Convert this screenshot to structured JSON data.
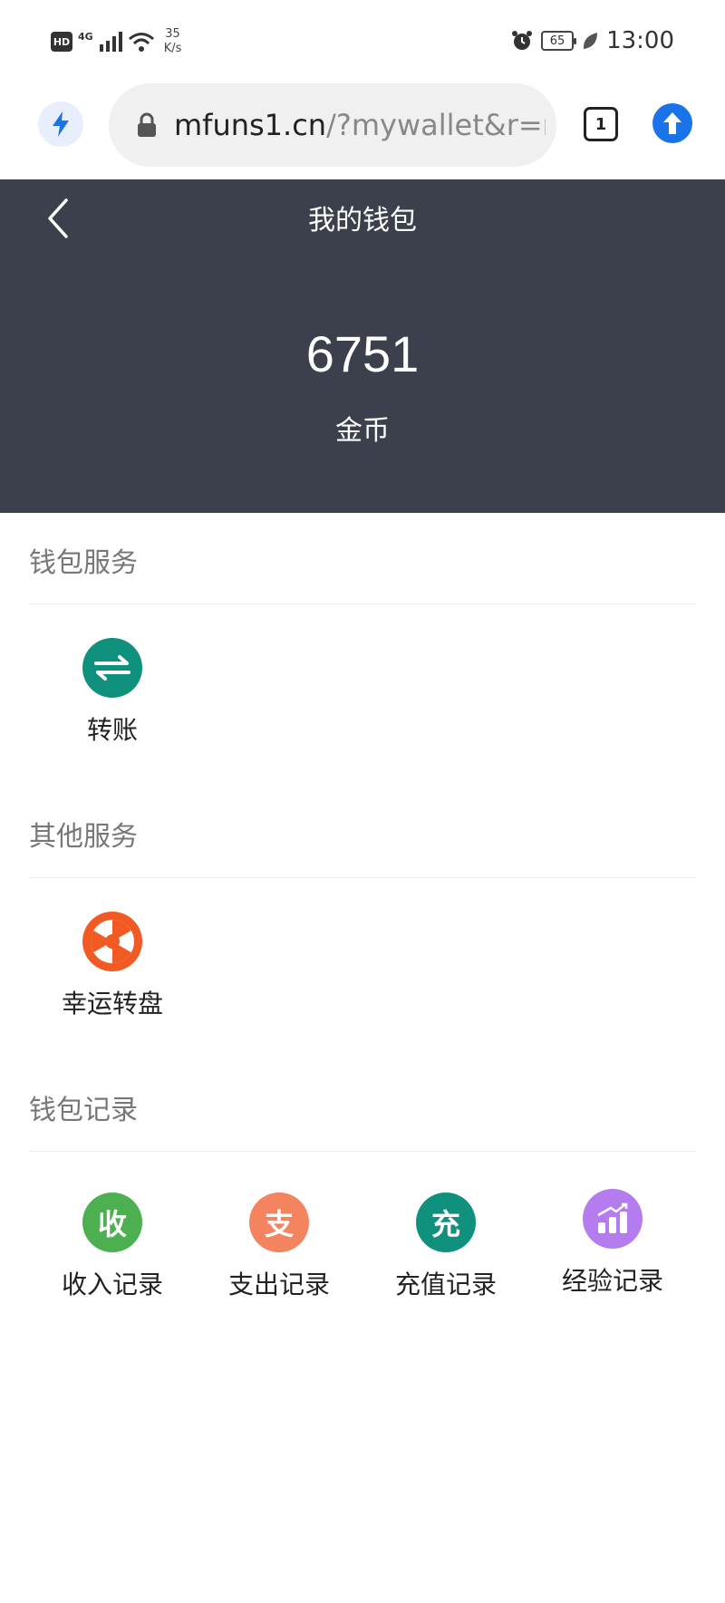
{
  "status": {
    "hd": "HD",
    "signal": "4G",
    "net_speed_top": "35",
    "net_speed_bottom": "K/s",
    "battery": "65",
    "time": "13:00"
  },
  "browser": {
    "url_host": "mfuns1.cn",
    "url_path": "/?mywallet&r=ns",
    "tabs_count": "1"
  },
  "header": {
    "title": "我的钱包",
    "balance": "6751",
    "unit": "金币"
  },
  "sections": {
    "wallet_services": {
      "title": "钱包服务",
      "items": [
        {
          "label": "转账",
          "icon": "transfer-icon",
          "color": "#10917e"
        }
      ]
    },
    "other_services": {
      "title": "其他服务",
      "items": [
        {
          "label": "幸运转盘",
          "icon": "lucky-wheel-icon",
          "color": "#f25a24"
        }
      ]
    },
    "wallet_records": {
      "title": "钱包记录",
      "items": [
        {
          "label": "收入记录",
          "icon_text": "收",
          "color": "#4caf50"
        },
        {
          "label": "支出记录",
          "icon_text": "支",
          "color": "#f4845f"
        },
        {
          "label": "充值记录",
          "icon_text": "充",
          "color": "#10917e"
        },
        {
          "label": "经验记录",
          "icon": "bar-chart-icon",
          "color": "#b57cf0"
        }
      ]
    }
  }
}
